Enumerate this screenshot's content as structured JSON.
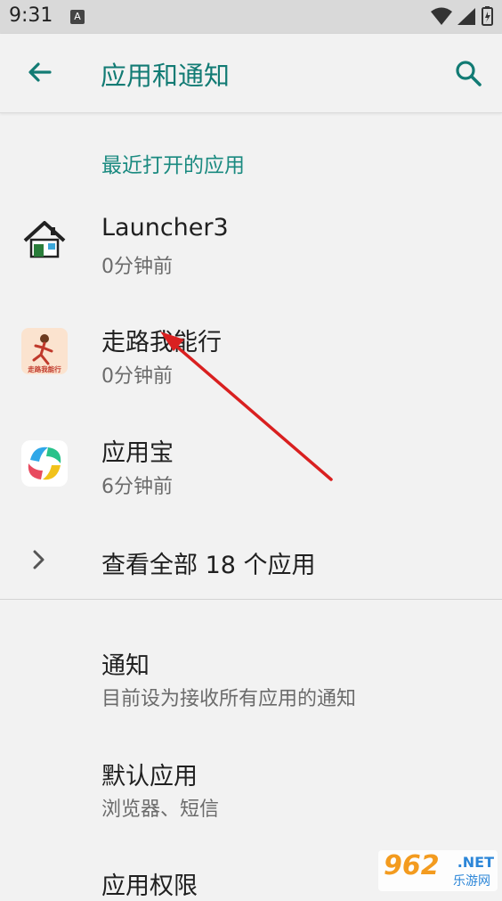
{
  "status_bar": {
    "time": "9:31",
    "a_label": "A"
  },
  "app_bar": {
    "title": "应用和通知",
    "back_icon": "arrow-left-icon",
    "search_icon": "search-icon"
  },
  "recent_section": {
    "header": "最近打开的应用",
    "apps": [
      {
        "name": "Launcher3",
        "time": "0分钟前",
        "icon": "house-icon"
      },
      {
        "name": "走路我能行",
        "time": "0分钟前",
        "icon": "walking-app-icon",
        "icon_text": "走路我能行"
      },
      {
        "name": "应用宝",
        "time": "6分钟前",
        "icon": "yingyongbao-icon"
      }
    ],
    "see_all": "查看全部 18 个应用"
  },
  "settings": [
    {
      "title": "通知",
      "subtitle": "目前设为接收所有应用的通知"
    },
    {
      "title": "默认应用",
      "subtitle": "浏览器、短信"
    },
    {
      "title": "应用权限",
      "subtitle": ""
    }
  ],
  "watermark": {
    "logo": "962",
    "net": ".NET",
    "sub": "乐游网"
  },
  "colors": {
    "accent": "#127b74",
    "header_accent": "#1a8a80",
    "arrow": "#d92020"
  }
}
